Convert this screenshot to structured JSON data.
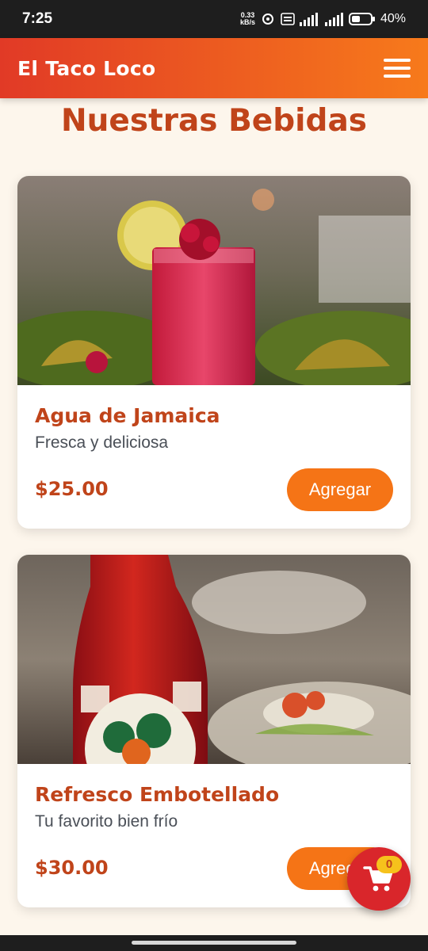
{
  "status_bar": {
    "time": "7:25",
    "net_speed_value": "0.33",
    "net_speed_unit": "kB/s",
    "battery": "40%"
  },
  "app_bar": {
    "title": "El Taco Loco",
    "menu_icon": "hamburger-menu-icon"
  },
  "page": {
    "title": "Nuestras Bebidas"
  },
  "items": [
    {
      "name": "Agua de Jamaica",
      "description": "Fresca y deliciosa",
      "price": "$25.00",
      "button_label": "Agregar"
    },
    {
      "name": "Refresco Embotellado",
      "description": "Tu favorito bien frío",
      "price": "$30.00",
      "button_label": "Agregar"
    }
  ],
  "cart": {
    "icon": "shopping-cart-icon",
    "count": "0"
  },
  "colors": {
    "header_start": "#E13A26",
    "header_end": "#F77A1B",
    "accent": "#F57416",
    "title": "#C0441A",
    "cart_fab": "#D9262B",
    "badge": "#F6C21C",
    "background": "#FDF6EC"
  }
}
